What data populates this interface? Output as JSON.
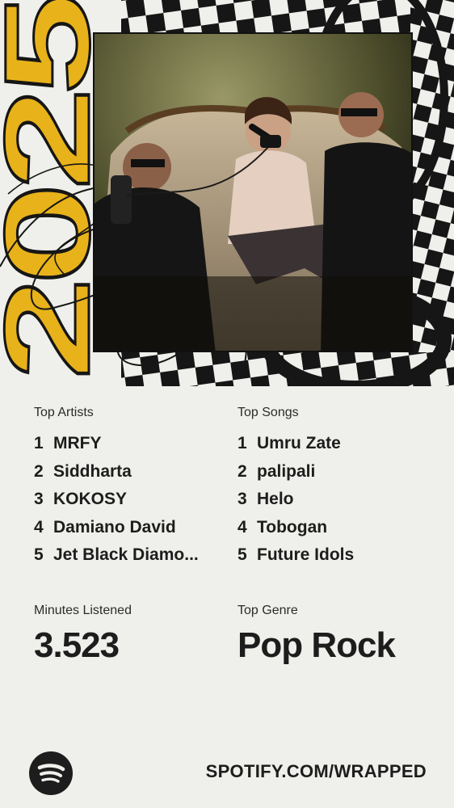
{
  "brand": {
    "year": "2025",
    "url": "SPOTIFY.COM/WRAPPED",
    "logo_icon": "spotify-logo-icon",
    "accent_color": "#e8b21a"
  },
  "top_artists": {
    "heading": "Top Artists",
    "items": [
      {
        "rank": "1",
        "name": "MRFY"
      },
      {
        "rank": "2",
        "name": "Siddharta"
      },
      {
        "rank": "3",
        "name": "KOKOSY"
      },
      {
        "rank": "4",
        "name": "Damiano David"
      },
      {
        "rank": "5",
        "name": "Jet Black Diamo..."
      }
    ]
  },
  "top_songs": {
    "heading": "Top Songs",
    "items": [
      {
        "rank": "1",
        "name": "Umru Zate"
      },
      {
        "rank": "2",
        "name": "palipali"
      },
      {
        "rank": "3",
        "name": "Helo"
      },
      {
        "rank": "4",
        "name": "Tobogan"
      },
      {
        "rank": "5",
        "name": "Future Idols"
      }
    ]
  },
  "minutes": {
    "label": "Minutes Listened",
    "value": "3.523"
  },
  "genre": {
    "label": "Top Genre",
    "value": "Pop Rock"
  }
}
